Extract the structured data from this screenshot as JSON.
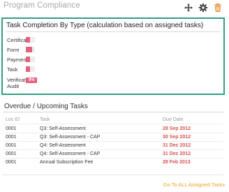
{
  "header": {
    "title": "Program Compliance",
    "icons": [
      "move-icon",
      "gear-icon",
      "trash-icon"
    ],
    "accent_color": "#e5943c"
  },
  "completion_panel": {
    "title": "Task Completion By Type (calculation based on assigned tasks)",
    "border_color": "#2e9e85",
    "rows": [
      {
        "label": "Certification",
        "percent_label": "",
        "fill_fraction": 0.04
      },
      {
        "label": "Form",
        "percent_label": "",
        "fill_fraction": 0.07
      },
      {
        "label": "Payment",
        "percent_label": "",
        "fill_fraction": 0.04
      },
      {
        "label": "Task",
        "percent_label": "",
        "fill_fraction": 0.04
      },
      {
        "label": "Verification Audit",
        "percent_label": "9%",
        "fill_fraction": 0.09
      }
    ]
  },
  "upcoming": {
    "title": "Overdue / Upcoming Tasks",
    "columns": {
      "loc": "Loc ID",
      "task": "Task",
      "due": "Due Date"
    },
    "rows": [
      {
        "loc": "0001",
        "task": "Q3: Self-Assessment",
        "due": "28 Sep 2012"
      },
      {
        "loc": "0001",
        "task": "Q3: Self-Assessment - CAP",
        "due": "30 Sep 2012"
      },
      {
        "loc": "0001",
        "task": "Q4: Self-Assessment",
        "due": "31 Dec 2012"
      },
      {
        "loc": "0001",
        "task": "Q4: Self-Assessment - CAP",
        "due": "31 Dec 2012"
      },
      {
        "loc": "0001",
        "task": "Annual Subscription Fee",
        "due": "28 Feb 2013"
      }
    ],
    "due_color": "#d9534f",
    "footer_link": "Go To ALL Assigned Tasks"
  }
}
